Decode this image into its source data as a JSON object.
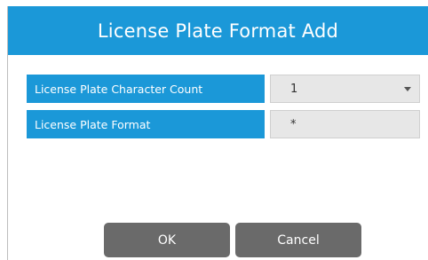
{
  "dialog": {
    "title": "License Plate Format Add"
  },
  "fields": {
    "character_count": {
      "label": "License Plate Character Count",
      "value": "1"
    },
    "plate_format": {
      "label": "License Plate Format",
      "value": "*"
    }
  },
  "buttons": {
    "ok_label": "OK",
    "cancel_label": "Cancel"
  },
  "colors": {
    "accent": "#1b98d8",
    "button": "#6a6a6a",
    "field_bg": "#e7e7e7"
  },
  "icons": {
    "dropdown": "chevron-down-icon"
  }
}
